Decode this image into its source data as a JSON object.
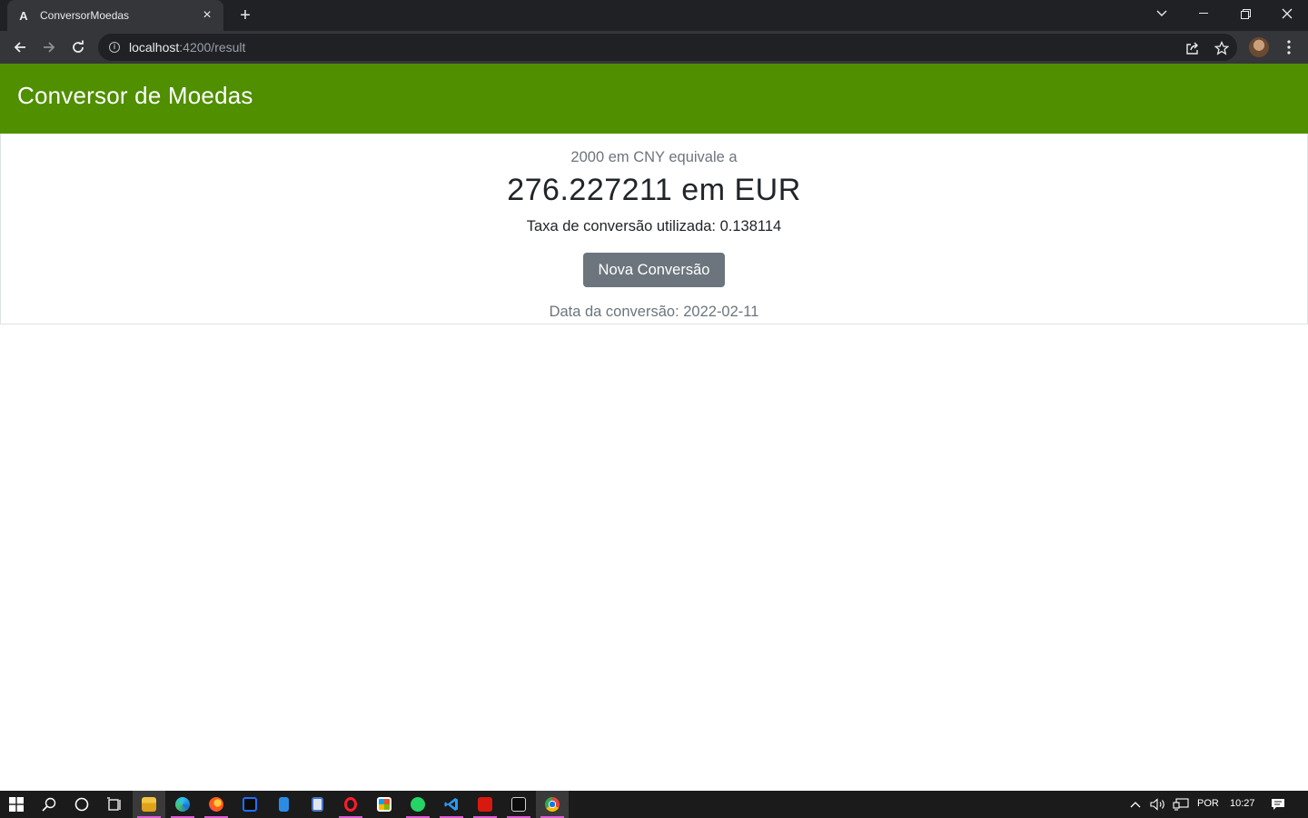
{
  "browser": {
    "tab_title": "ConversorMoedas",
    "tab_favicon": "A",
    "url_host": "localhost",
    "url_rest": ":4200/result"
  },
  "app": {
    "title": "Conversor de Moedas",
    "subtitle": "2000 em CNY equivale a",
    "result": "276.227211 em EUR",
    "rate_text": "Taxa de conversão utilizada: 0.138114",
    "new_conversion_label": "Nova Conversão",
    "date_text": "Data da conversão: 2022-02-11"
  },
  "colors": {
    "header_green": "#4f8f00",
    "button_gray": "#6c757d"
  },
  "taskbar": {
    "language": "POR",
    "time": "10:27",
    "apps": [
      "start-icon",
      "search-icon",
      "cortana-icon",
      "task-view-icon",
      "file-explorer-icon",
      "edge-icon",
      "firefox-icon",
      "intellij-icon",
      "notepad-icon",
      "document-icon",
      "opera-icon",
      "store-icon",
      "whatsapp-icon",
      "vscode-icon",
      "acrobat-icon",
      "terminal-icon",
      "chrome-icon"
    ]
  }
}
